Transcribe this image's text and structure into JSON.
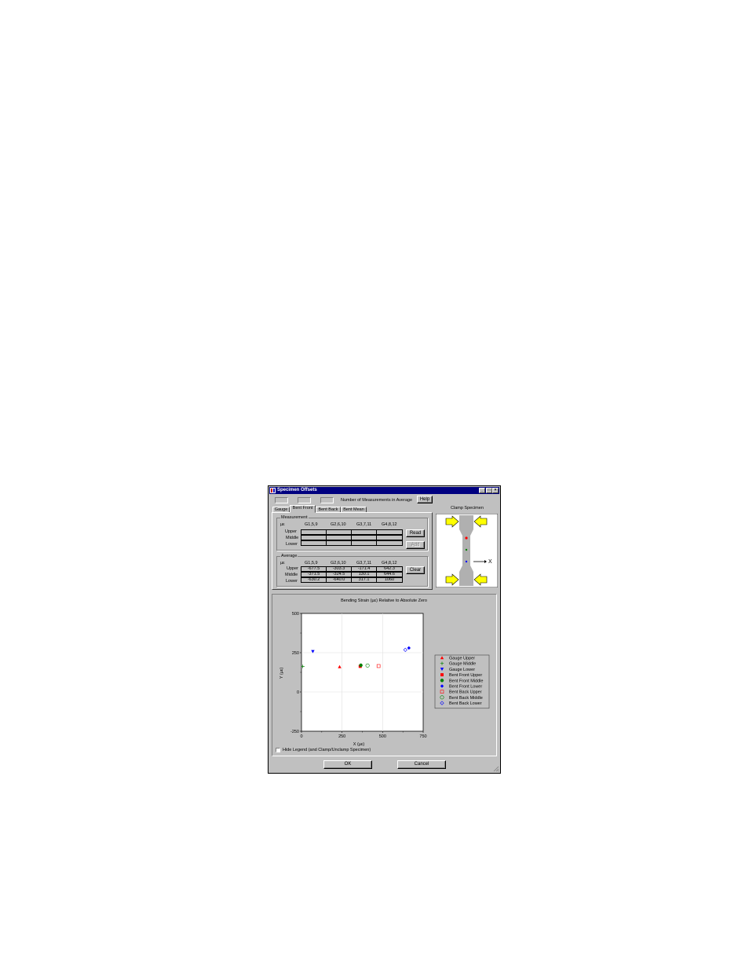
{
  "window": {
    "title": "Specimen Offsets",
    "buttons": {
      "minimize": "_",
      "maximize": "□",
      "close": "×"
    }
  },
  "top": {
    "num_measurements_label": "Number of Measurements in Average",
    "help_label": "Help"
  },
  "tabs": [
    "Gauge",
    "Bent Front",
    "Bent Back",
    "Bent Mean"
  ],
  "active_tab": 1,
  "measurement": {
    "group_label": "Measurement",
    "unit": "µε",
    "columns": [
      "G1,5,9",
      "G2,6,10",
      "G3,7,11",
      "G4,8,12"
    ],
    "rows": [
      "Upper",
      "Middle",
      "Lower"
    ],
    "read_label": "Read",
    "add_label": "Add"
  },
  "average": {
    "group_label": "Average",
    "unit": "µε",
    "columns": [
      "G1,5,9",
      "G2,6,10",
      "G3,7,11",
      "G4,8,12"
    ],
    "rows": [
      {
        "label": "Upper",
        "values": [
          "-677.5",
          "-303.3",
          "-171.4",
          "642.3"
        ]
      },
      {
        "label": "Middle",
        "values": [
          "-371.5",
          "-324.5",
          "130.1",
          "644.6"
        ]
      },
      {
        "label": "Lower",
        "values": [
          "-630.2",
          "-640.0",
          "317.1",
          "1060"
        ]
      }
    ],
    "clear_label": "Clear"
  },
  "clamp": {
    "title": "Clamp Specimen",
    "x_label": "X",
    "dot_colors": [
      "#ff0000",
      "#008000",
      "#0000ff"
    ],
    "arrow_color": "#ffff00"
  },
  "chart_data": {
    "type": "scatter",
    "title": "Bending Strain (µε) Relative to Absolute Zero",
    "xlabel": "X (µε)",
    "ylabel": "Y (µε)",
    "xlim": [
      0,
      750
    ],
    "ylim": [
      -250,
      500
    ],
    "xticks": [
      0,
      250,
      500,
      750
    ],
    "yticks": [
      -250,
      0,
      250,
      500
    ],
    "grid": true,
    "legend": "right",
    "series": [
      {
        "name": "Gauge Upper",
        "color": "#ff0000",
        "marker": "triangle-up",
        "x": 235,
        "y": 160
      },
      {
        "name": "Gauge Middle",
        "color": "#008000",
        "marker": "plus",
        "x": 8,
        "y": 163
      },
      {
        "name": "Gauge Lower",
        "color": "#0000ff",
        "marker": "triangle-down",
        "x": 70,
        "y": 258
      },
      {
        "name": "Bent Front Upper",
        "color": "#ff0000",
        "marker": "square-filled",
        "x": 362,
        "y": 163
      },
      {
        "name": "Bent Front Middle",
        "color": "#008000",
        "marker": "circle-filled",
        "x": 366,
        "y": 170
      },
      {
        "name": "Bent Front Lower",
        "color": "#0000ff",
        "marker": "diamond-filled",
        "x": 662,
        "y": 280
      },
      {
        "name": "Bent Back Upper",
        "color": "#ff0000",
        "marker": "square-open",
        "x": 475,
        "y": 165
      },
      {
        "name": "Bent Back Middle",
        "color": "#008000",
        "marker": "circle-open",
        "x": 407,
        "y": 168
      },
      {
        "name": "Bent Back Lower",
        "color": "#0000ff",
        "marker": "diamond-open",
        "x": 640,
        "y": 268
      }
    ]
  },
  "hide_legend_label": "Hide Legend (and Clamp/Unclamp Specimen)",
  "footer": {
    "ok_label": "OK",
    "cancel_label": "Cancel"
  }
}
